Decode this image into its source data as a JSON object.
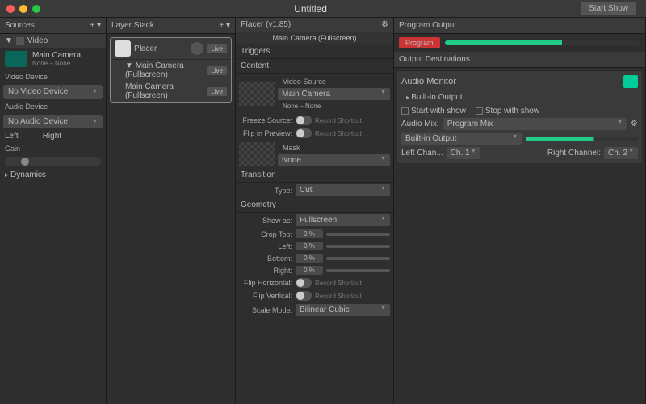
{
  "title": "Untitled",
  "startshow": "Start Show",
  "sources": {
    "title": "Sources",
    "video": "Video",
    "main_camera": "Main Camera",
    "main_sub": "None – None",
    "video_device": "Video Device",
    "no_video": "No Video Device",
    "audio_device": "Audio Device",
    "no_audio": "No Audio Device",
    "left": "Left",
    "right": "Right",
    "gain": "Gain",
    "dynamics": "Dynamics"
  },
  "layers": {
    "title": "Layer Stack",
    "placer": "Placer",
    "live": "Live",
    "item1": "Main Camera (Fullscreen)",
    "item2": "Main Camera (Fullscreen)"
  },
  "inspector": {
    "title": "Placer (v1.85)",
    "subtitle": "Main Camera (Fullscreen)",
    "triggers": "Triggers",
    "content": "Content",
    "video_source": "Video Source",
    "main_camera": "Main Camera",
    "none": "None – None",
    "freeze": "Freeze Source:",
    "flip_preview": "Flip in Preview:",
    "record": "Record Shortcut",
    "mask": "Mask",
    "mask_none": "None",
    "transition": "Transition",
    "type": "Type:",
    "cut": "Cut",
    "geometry": "Geometry",
    "show_as": "Show as:",
    "fullscreen": "Fullscreen",
    "crop_top": "Crop Top:",
    "left": "Left:",
    "bottom": "Bottom:",
    "right": "Right:",
    "zero": "0 %",
    "flip_h": "Flip Horizontal:",
    "flip_v": "Flip Vertical:",
    "scale_mode": "Scale Mode:",
    "bilinear": "Bilinear Cubic"
  },
  "output": {
    "title": "Program Output",
    "program": "Program",
    "dest": "Output Destinations",
    "monitor": "Audio Monitor",
    "builtin": "Built-in Output",
    "start_show": "Start with show",
    "stop_show": "Stop with show",
    "audio_mix": "Audio Mix:",
    "program_mix": "Program Mix",
    "left_ch": "Left Chan...",
    "ch1": "Ch. 1",
    "right_ch": "Right Channel:",
    "ch2": "Ch. 2"
  }
}
